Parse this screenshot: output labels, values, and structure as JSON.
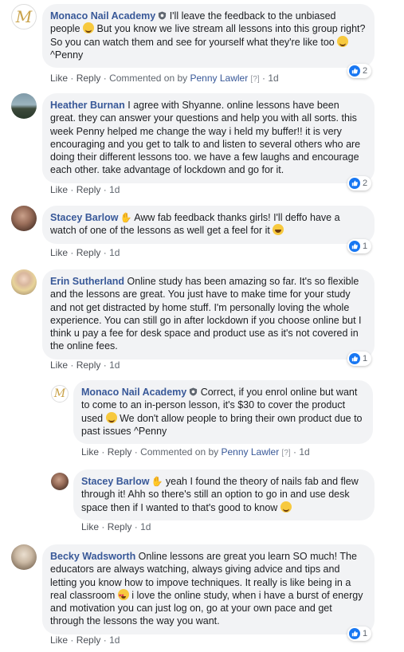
{
  "actions": {
    "like": "Like",
    "reply": "Reply",
    "dot": "·",
    "commented_on_by": "Commented on by",
    "question": "[?]"
  },
  "colors": {
    "name": "#385898",
    "bubble": "#f2f3f5",
    "like_blue": "#1877f2"
  },
  "comments": [
    {
      "name": "Monaco Nail Academy",
      "text_before": " I'll leave the feedback to the unbiased people ",
      "text_mid": " But you know we live stream all lessons into this group right? So you can watch them and see for yourself what they're like too ",
      "text_after": " ^Penny",
      "commented_by": "Penny Lawler",
      "time": "1d",
      "reactions": "2"
    },
    {
      "name": "Heather Burnan",
      "text": " I agree with Shyanne. online lessons have been great. they can answer your questions and help you with all sorts. this week Penny helped me change the way i held my buffer!! it is very encouraging and you get to talk to and listen to several others who are doing their different lessons too. we have a few laughs and encourage each other. take advantage of lockdown and go for it.",
      "time": "1d",
      "reactions": "2"
    },
    {
      "name": "Stacey Barlow",
      "text": " Aww fab feedback thanks girls! I'll deffo have a watch of one of the lessons as well get a feel for it ",
      "time": "1d",
      "reactions": "1"
    },
    {
      "name": "Erin Sutherland",
      "text": " Online study has been amazing so far. It's so flexible and the lessons are great. You just have to make time for your study and not get distracted by home stuff. I'm personally loving the whole experience. You can still go in after lockdown if you choose online but I think u pay a fee for desk space and product use as it's not covered in the online fees.",
      "time": "1d",
      "reactions": "1"
    },
    {
      "name": "Monaco Nail Academy",
      "text_before": " Correct, if you enrol online but want to come to an in-person lesson, it's $30 to cover the product used ",
      "text_after": " We don't allow people to bring their own product due to past issues ^Penny",
      "commented_by": "Penny Lawler",
      "time": "1d"
    },
    {
      "name": "Stacey Barlow",
      "text": " yeah I found the theory of nails fab and flew through it! Ahh so there's still an option to go in and use desk space then if I wanted to that's good to know ",
      "time": "1d"
    },
    {
      "name": "Becky Wadsworth",
      "text_before": " Online lessons are great you learn SO much! The educators are always watching, always giving advice and tips and letting you know how to impove techniques. It really is like being in a real classroom ",
      "text_after": " i love the online study, when i have a burst of energy and motivation you can just log on, go at your own pace and get through the lessons the way you want.",
      "time": "1d",
      "reactions": "1"
    }
  ]
}
